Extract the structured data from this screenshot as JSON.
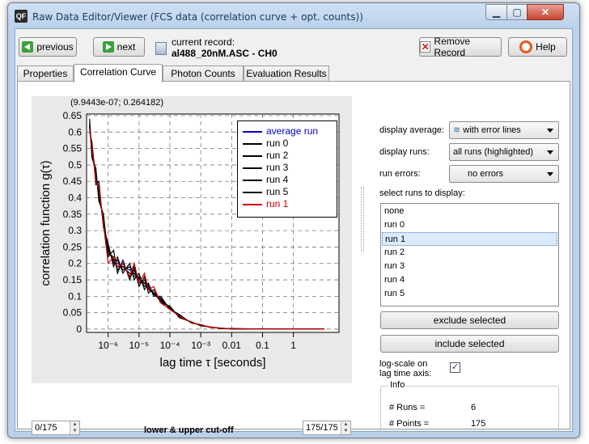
{
  "window": {
    "title": "Raw Data Editor/Viewer (FCS data (correlation curve + opt. counts))",
    "icon_text": "QF",
    "controls": {
      "minimize": "▁",
      "maximize": "▢",
      "close": "✕"
    }
  },
  "toolbar": {
    "previous_label": "previous",
    "next_label": "next",
    "current_record_label": "current record:",
    "current_record_value": "al488_20nM.ASC - CH0",
    "remove_label": "Remove Record",
    "help_label": "Help"
  },
  "tabs": [
    {
      "label": "Properties",
      "active": false
    },
    {
      "label": "Correlation Curve",
      "active": true
    },
    {
      "label": "Photon Counts",
      "active": false
    },
    {
      "label": "Evaluation Results",
      "active": false
    }
  ],
  "plot": {
    "cursor_readout": "(9.9443e-07; 0.264182)",
    "cutoff_lower": "0/175",
    "cutoff_upper": "175/175",
    "cutoff_label": "lower & upper cut-off"
  },
  "chart_data": {
    "type": "line",
    "xlabel": "lag time τ [seconds]",
    "ylabel": "correlation function g(τ)",
    "xscale": "log",
    "xlim": [
      2e-07,
      30
    ],
    "ylim": [
      -0.01,
      0.655
    ],
    "x_ticks": [
      "10⁻⁶",
      "10⁻⁵",
      "10⁻⁴",
      "10⁻³",
      "0.01",
      "0.1",
      "1"
    ],
    "x_tick_exponents": [
      -6,
      -5,
      -4,
      -3,
      -2,
      -1,
      0
    ],
    "y_ticks": [
      0,
      0.05,
      0.1,
      0.15,
      0.2,
      0.25,
      0.3,
      0.35,
      0.4,
      0.45,
      0.5,
      0.55,
      0.6,
      0.65
    ],
    "grid": true,
    "legend_position": "top-right",
    "x": [
      2.5e-07,
      3e-07,
      4e-07,
      5e-07,
      7e-07,
      1e-06,
      1.5e-06,
      2e-06,
      3e-06,
      5e-06,
      7e-06,
      1e-05,
      1.5e-05,
      2e-05,
      3e-05,
      5e-05,
      0.0001,
      0.0002,
      0.0005,
      0.001,
      0.002,
      0.005,
      0.01,
      0.1,
      1,
      10
    ],
    "series": [
      {
        "name": "average run",
        "color": "#0000cc",
        "values": [
          0.62,
          0.55,
          0.47,
          0.42,
          0.33,
          0.24,
          0.21,
          0.2,
          0.19,
          0.18,
          0.17,
          0.155,
          0.14,
          0.13,
          0.11,
          0.09,
          0.065,
          0.04,
          0.02,
          0.012,
          0.006,
          0.002,
          0.001,
          0.0,
          0.0,
          0.0
        ]
      },
      {
        "name": "run 0",
        "color": "#000000",
        "values": [
          0.64,
          0.52,
          0.49,
          0.39,
          0.35,
          0.22,
          0.24,
          0.17,
          0.21,
          0.15,
          0.19,
          0.13,
          0.16,
          0.11,
          0.12,
          0.08,
          0.07,
          0.035,
          0.022,
          0.01,
          0.007,
          0.001,
          0.002,
          0.0,
          0.0,
          0.0
        ]
      },
      {
        "name": "run 2",
        "color": "#000000",
        "values": [
          0.6,
          0.57,
          0.44,
          0.45,
          0.31,
          0.26,
          0.19,
          0.22,
          0.17,
          0.2,
          0.15,
          0.17,
          0.12,
          0.14,
          0.1,
          0.1,
          0.06,
          0.045,
          0.018,
          0.014,
          0.005,
          0.003,
          0.0,
          0.001,
          0.0,
          0.0
        ]
      },
      {
        "name": "run 3",
        "color": "#000000",
        "values": [
          0.63,
          0.54,
          0.48,
          0.4,
          0.34,
          0.23,
          0.22,
          0.18,
          0.2,
          0.16,
          0.18,
          0.14,
          0.15,
          0.12,
          0.11,
          0.085,
          0.068,
          0.038,
          0.021,
          0.011,
          0.006,
          0.002,
          0.001,
          0.0,
          0.0,
          0.0
        ]
      },
      {
        "name": "run 4",
        "color": "#000000",
        "values": [
          0.61,
          0.56,
          0.46,
          0.43,
          0.32,
          0.25,
          0.2,
          0.21,
          0.18,
          0.19,
          0.16,
          0.16,
          0.13,
          0.135,
          0.105,
          0.095,
          0.062,
          0.042,
          0.019,
          0.013,
          0.006,
          0.002,
          0.001,
          0.0,
          0.0,
          0.0
        ]
      },
      {
        "name": "run 5",
        "color": "#000000",
        "values": [
          0.62,
          0.53,
          0.47,
          0.41,
          0.33,
          0.24,
          0.21,
          0.19,
          0.19,
          0.17,
          0.17,
          0.15,
          0.14,
          0.125,
          0.11,
          0.09,
          0.064,
          0.04,
          0.02,
          0.012,
          0.006,
          0.002,
          0.001,
          0.0,
          0.0,
          0.0
        ]
      },
      {
        "name": "run 1",
        "color": "#cc0000",
        "values": [
          0.61,
          0.56,
          0.45,
          0.43,
          0.32,
          0.2,
          0.22,
          0.19,
          0.2,
          0.16,
          0.2,
          0.14,
          0.17,
          0.12,
          0.13,
          0.08,
          0.06,
          0.04,
          0.02,
          0.012,
          0.006,
          0.002,
          0.001,
          0.0,
          0.0,
          0.0
        ]
      }
    ]
  },
  "options": {
    "display_average_label": "display average:",
    "display_average_value": "with error lines",
    "display_runs_label": "display runs:",
    "display_runs_value": "all runs (highlighted)",
    "run_errors_label": "run errors:",
    "run_errors_value": "no errors",
    "select_runs_label": "select runs to display:",
    "run_list": [
      {
        "label": "none",
        "selected": false
      },
      {
        "label": "run 0",
        "selected": false
      },
      {
        "label": "run 1",
        "selected": true
      },
      {
        "label": "run 2",
        "selected": false
      },
      {
        "label": "run 3",
        "selected": false
      },
      {
        "label": "run 4",
        "selected": false
      },
      {
        "label": "run 5",
        "selected": false
      }
    ],
    "exclude_label": "exclude selected",
    "include_label": "include selected",
    "logscale_label_line1": "log-scale on",
    "logscale_label_line2": "lag time axis:",
    "logscale_checked": true
  },
  "info": {
    "title": "Info",
    "runs_label": "# Runs =",
    "runs_value": "6",
    "points_label": "# Points =",
    "points_value": "175"
  }
}
